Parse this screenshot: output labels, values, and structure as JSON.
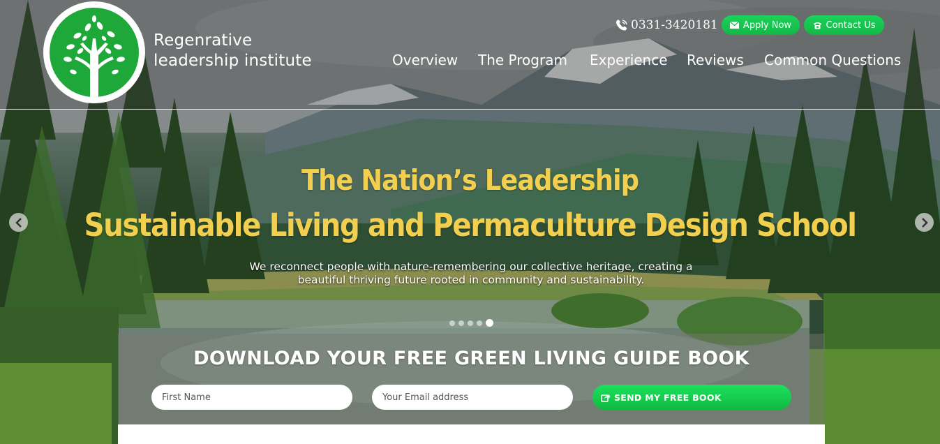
{
  "brand": {
    "line1": "Regenrative",
    "line2": "leadership institute"
  },
  "header": {
    "phone": "0331-3420181",
    "apply_label": "Apply Now",
    "contact_label": "Contact Us"
  },
  "nav": [
    "Overview",
    "The Program",
    "Experience",
    "Reviews",
    "Common Questions"
  ],
  "hero": {
    "title_line1": "The Nation’s Leadership",
    "title_line2": "Sustainable Living and Permaculture Design School",
    "subtitle": "We reconnect people with nature-remembering our collective heritage, creating a beautiful thriving future rooted in community and sustainability.",
    "slide_count": 5,
    "active_slide": 5
  },
  "form": {
    "title": "DOWNLOAD YOUR FREE GREEN LIVING GUIDE BOOK",
    "first_name_placeholder": "First Name",
    "email_placeholder": "Your Email address",
    "submit_label": "SEND MY FREE BOOK"
  },
  "colors": {
    "accent_green": "#1bd25a",
    "hero_title": "#f2cf4e",
    "logo_green": "#1fa83a"
  },
  "icons": {
    "phone": "phone-icon",
    "apply": "envelope-icon",
    "contact": "telephone-icon",
    "submit": "share-icon",
    "prev": "chevron-left-icon",
    "next": "chevron-right-icon"
  }
}
